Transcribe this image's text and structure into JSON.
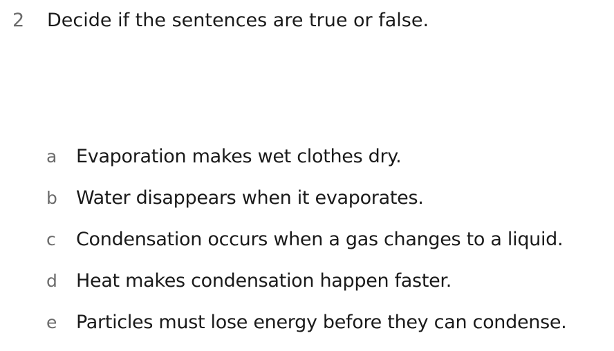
{
  "question": {
    "number": "2",
    "prompt": "Decide if the sentences are true or false."
  },
  "statements": [
    {
      "letter": "a",
      "text": "Evaporation makes wet clothes dry."
    },
    {
      "letter": "b",
      "text": "Water disappears when it evaporates."
    },
    {
      "letter": "c",
      "text": "Condensation occurs when a gas changes to a liquid."
    },
    {
      "letter": "d",
      "text": "Heat makes condensation happen faster."
    },
    {
      "letter": "e",
      "text": "Particles must lose energy before they can condense."
    }
  ]
}
